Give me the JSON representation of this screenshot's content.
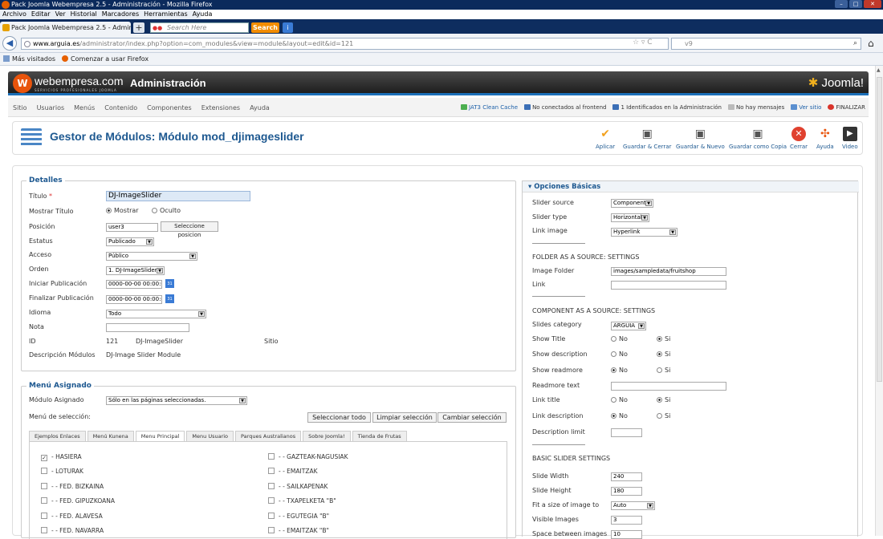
{
  "window": {
    "title": "Pack Joomla Webempresa 2.5 - Administración - Mozilla Firefox"
  },
  "browser_menu": [
    "Archivo",
    "Editar",
    "Ver",
    "Historial",
    "Marcadores",
    "Herramientas",
    "Ayuda"
  ],
  "tab": {
    "title": "Pack Joomla Webempresa 2.5 - Adminis...",
    "new_tab": "+"
  },
  "search": {
    "placeholder": "Search Here",
    "button": "Search",
    "engine_label": "v9"
  },
  "address": {
    "url_host": "www.arguia.es",
    "url_path": "/administrator/index.php?option=com_modules&view=module&layout=edit&id=121"
  },
  "bookmarks": [
    "Más visitados",
    "Comenzar a usar Firefox"
  ],
  "joomla": {
    "brand": "webempresa.com",
    "brand_sub": "SERVICIOS PROFESIONALES JOOMLA",
    "admin_title": "Administración",
    "logo_text": "Joomla!",
    "menu": [
      "Sitio",
      "Usuarios",
      "Menús",
      "Contenido",
      "Componentes",
      "Extensiones",
      "Ayuda"
    ],
    "status": [
      "JAT3 Clean Cache",
      "No conectados al frontend",
      "1 Identificados en la Administración",
      "No hay mensajes",
      "Ver sitio",
      "FINALIZAR"
    ]
  },
  "toolbar": {
    "title": "Gestor de Módulos: Módulo mod_djimageslider",
    "buttons": [
      "Aplicar",
      "Guardar & Cerrar",
      "Guardar & Nuevo",
      "Guardar como Copia",
      "Cerrar",
      "Ayuda",
      "Video"
    ]
  },
  "details": {
    "legend": "Detalles",
    "title_label": "Título",
    "required_mark": "*",
    "title_value": "DJ-ImageSlider",
    "show_title_label": "Mostrar Título",
    "show_option": "Mostrar",
    "hide_option": "Oculto",
    "position_label": "Posición",
    "position_value": "user3",
    "position_button": "Seleccione posicion",
    "status_label": "Estatus",
    "status_value": "Publicado",
    "access_label": "Acceso",
    "access_value": "Público",
    "order_label": "Orden",
    "order_value": "1. DJ-ImageSlider",
    "publish_start_label": "Iniciar Publicación",
    "publish_start_value": "0000-00-00 00:00:00",
    "publish_end_label": "Finalizar Publicación",
    "publish_end_value": "0000-00-00 00:00:00",
    "calendar_label": "31",
    "language_label": "Idioma",
    "language_value": "Todo",
    "note_label": "Nota",
    "id_label": "ID",
    "id_value": "121",
    "id_name": "DJ-ImageSlider",
    "id_site": "Sitio",
    "desc_label": "Descripción Módulos",
    "desc_value": "DJ-Image Slider Module"
  },
  "assigned": {
    "legend": "Menú Asignado",
    "module_label": "Módulo Asignado",
    "module_value": "Sólo en las páginas seleccionadas.",
    "selection_label": "Menú de selección:",
    "btn_select_all": "Seleccionar todo",
    "btn_clear": "Limpiar selección",
    "btn_change": "Cambiar selección",
    "tabs": [
      "Ejemplos Enlaces",
      "Menú Kunena",
      "Menu Principal",
      "Menu Usuario",
      "Parques Australianos",
      "Sobre Joomla!",
      "Tienda de Frutas"
    ],
    "left_items": [
      {
        "label": "- HASIERA",
        "checked": true
      },
      {
        "label": "- LOTURAK",
        "checked": false
      },
      {
        "label": "- - FED. BIZKAINA",
        "checked": false
      },
      {
        "label": "- - FED. GIPUZKOANA",
        "checked": false
      },
      {
        "label": "- - FED. ALAVESA",
        "checked": false
      },
      {
        "label": "- - FED. NAVARRA",
        "checked": false
      }
    ],
    "right_items": [
      {
        "label": "- - GAZTEAK-NAGUSIAK",
        "checked": false
      },
      {
        "label": "- - EMAITZAK",
        "checked": false
      },
      {
        "label": "- - SAILKAPENAK",
        "checked": false
      },
      {
        "label": "- - TXAPELKETA \"B\"",
        "checked": false
      },
      {
        "label": "- - EGUTEGIA \"B\"",
        "checked": false
      },
      {
        "label": "- - EMAITZAK \"B\"",
        "checked": false
      }
    ]
  },
  "basic": {
    "heading": "Opciones Básicas",
    "slider_source_label": "Slider source",
    "slider_source_value": "Component",
    "slider_type_label": "Slider type",
    "slider_type_value": "Horizontal",
    "link_image_label": "Link image",
    "link_image_value": "Hyperlink",
    "folder_section": "FOLDER AS A SOURCE: SETTINGS",
    "image_folder_label": "Image Folder",
    "image_folder_value": "images/sampledata/fruitshop",
    "link_label": "Link",
    "component_section": "COMPONENT AS A SOURCE: SETTINGS",
    "slides_category_label": "Slides category",
    "slides_category_value": "ARGUIA",
    "show_title_label": "Show Title",
    "show_description_label": "Show description",
    "show_readmore_label": "Show readmore",
    "readmore_text_label": "Readmore text",
    "link_title_label": "Link title",
    "link_description_label": "Link description",
    "description_limit_label": "Description limit",
    "no": "No",
    "yes": "Si",
    "basic_section": "BASIC SLIDER SETTINGS",
    "slide_width_label": "Slide Width",
    "slide_width_value": "240",
    "slide_height_label": "Slide Height",
    "slide_height_value": "180",
    "fit_label": "Fit a size of image to",
    "fit_value": "Auto",
    "visible_label": "Visible Images",
    "visible_value": "3",
    "space_label": "Space between images",
    "space_value": "10"
  },
  "colors": {
    "accent": "#1d5890",
    "joomla_orange": "#e8540c",
    "header_dark": "#2a2a2a"
  }
}
